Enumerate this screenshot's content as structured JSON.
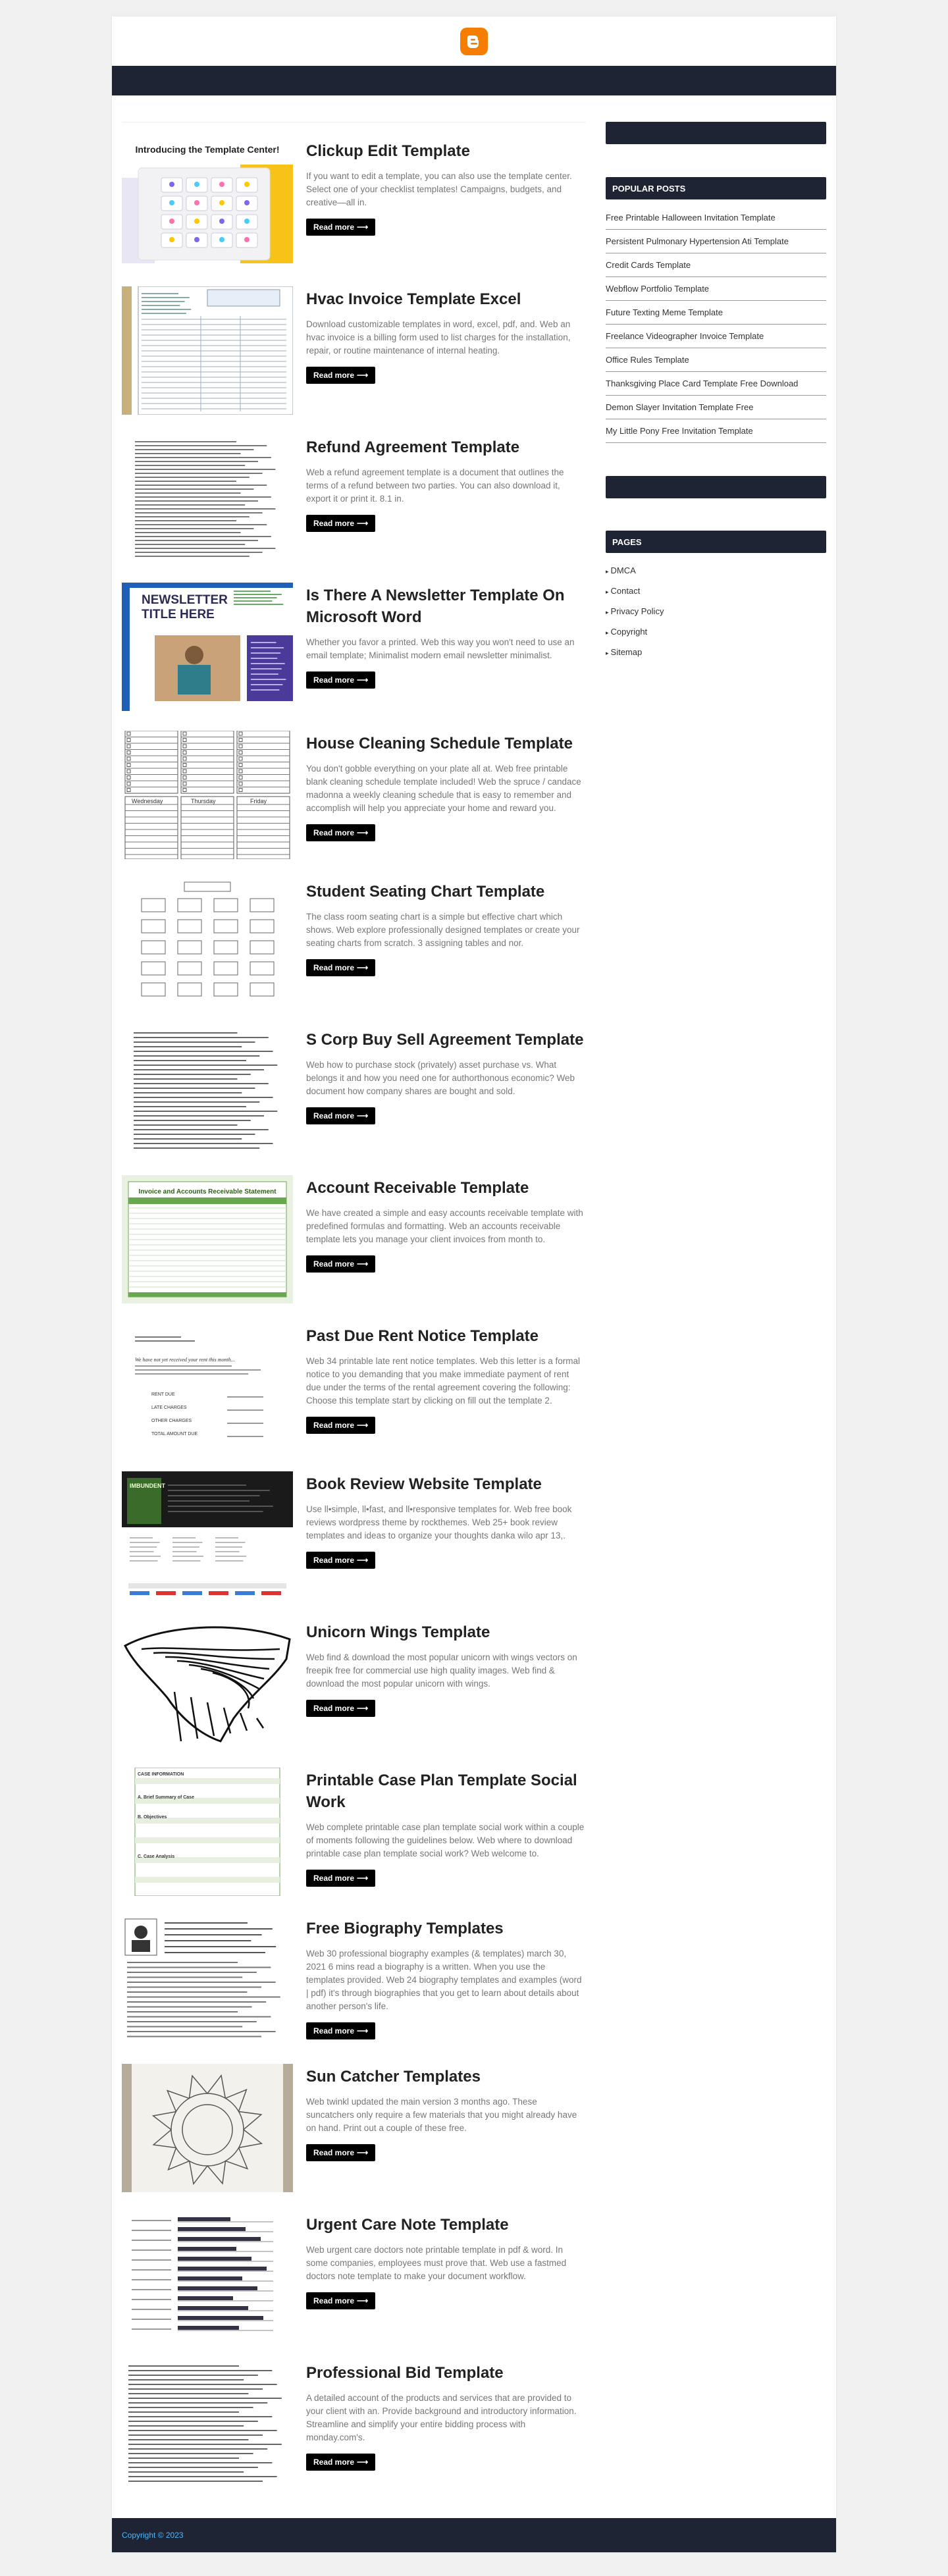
{
  "header": {
    "logo_icon": "blogger-icon",
    "logo_color": "#f57d00"
  },
  "nav": {
    "color": "#1e2433"
  },
  "read_more_label": "Read more",
  "posts": [
    {
      "title": "Clickup Edit Template",
      "snippet": "If you want to edit a template, you can also use the template center. Select one of your checklist templates! Campaigns, budgets, and creative—all in."
    },
    {
      "title": "Hvac Invoice Template Excel",
      "snippet": "Download customizable templates in word, excel, pdf, and. Web an hvac invoice is a billing form used to list charges for the installation, repair, or routine maintenance of internal heating."
    },
    {
      "title": "Refund Agreement Template",
      "snippet": "Web a refund agreement template is a document that outlines the terms of a refund between two parties. You can also download it, export it or print it. 8.1 in."
    },
    {
      "title": "Is There A Newsletter Template On Microsoft Word",
      "snippet": "Whether you favor a printed. Web this way you won't need to use an email template; Minimalist modern email newsletter minimalist."
    },
    {
      "title": "House Cleaning Schedule Template",
      "snippet": "You don't gobble everything on your plate all at. Web free printable blank cleaning schedule template included! Web the spruce / candace madonna a weekly cleaning schedule that is easy to remember and accomplish will help you appreciate your home and reward you."
    },
    {
      "title": "Student Seating Chart Template",
      "snippet": "The class room seating chart is a simple but effective chart which shows. Web explore professionally designed templates or create your seating charts from scratch. 3 assigning tables and nor."
    },
    {
      "title": "S Corp Buy Sell Agreement Template",
      "snippet": "Web how to purchase stock (privately) asset purchase vs. What belongs it and how you need one for authorthonous economic? Web document how company shares are bought and sold."
    },
    {
      "title": "Account Receivable Template",
      "snippet": "We have created a simple and easy accounts receivable template with predefined formulas and formatting. Web an accounts receivable template lets you manage your client invoices from month to."
    },
    {
      "title": "Past Due Rent Notice Template",
      "snippet": "Web 34 printable late rent notice templates. Web this letter is a formal notice to you demanding that you make immediate payment of rent due under the terms of the rental agreement covering the following: Choose this template start by clicking on fill out the template 2."
    },
    {
      "title": "Book Review Website Template",
      "snippet": "Use ll•simple, ll•fast, and ll•responsive templates for. Web free book reviews wordpress theme by rockthemes. Web 25+ book review templates and ideas to organize your thoughts danka wilo apr 13,."
    },
    {
      "title": "Unicorn Wings Template",
      "snippet": "Web find & download the most popular unicorn with wings vectors on freepik free for commercial use high quality images. Web find & download the most popular unicorn with wings."
    },
    {
      "title": "Printable Case Plan Template Social Work",
      "snippet": "Web complete printable case plan template social work within a couple of moments following the guidelines below. Web where to download printable case plan template social work? Web welcome to."
    },
    {
      "title": "Free Biography Templates",
      "snippet": "Web 30 professional biography examples (& templates) march 30, 2021 6 mins read a biography is a written. When you use the templates provided. Web 24 biography templates and examples (word | pdf) it's through biographies that you get to learn about details about another person's life."
    },
    {
      "title": "Sun Catcher Templates",
      "snippet": "Web twinkl updated the main version 3 months ago. These suncatchers only require a few materials that you might already have on hand. Print out a couple of these free."
    },
    {
      "title": "Urgent Care Note Template",
      "snippet": "Web urgent care doctors note printable template in pdf & word. In some companies, employees must prove that. Web use a fastmed doctors note template to make your document workflow."
    },
    {
      "title": "Professional Bid Template",
      "snippet": "A detailed account of the products and services that are provided to your client with an. Provide background and introductory information. Streamline and simplify your entire bidding process with monday.com's."
    }
  ],
  "sidebar": {
    "popular_title": "POPULAR POSTS",
    "popular": [
      "Free Printable Halloween Invitation Template",
      "Persistent Pulmonary Hypertension Ati Template",
      "Credit Cards Template",
      "Webflow Portfolio Template",
      "Future Texting Meme Template",
      "Freelance Videographer Invoice Template",
      "Office Rules Template",
      "Thanksgiving Place Card Template Free Download",
      "Demon Slayer Invitation Template Free",
      "My Little Pony Free Invitation Template"
    ],
    "pages_title": "PAGES",
    "pages": [
      "DMCA",
      "Contact",
      "Privacy Policy",
      "Copyright",
      "Sitemap"
    ]
  },
  "footer": {
    "copyright": "Copyright © 2023"
  }
}
